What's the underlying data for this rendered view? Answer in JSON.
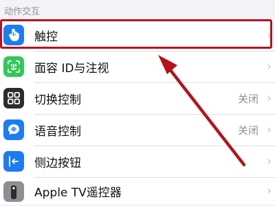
{
  "section": {
    "title": "动作交互"
  },
  "rows": [
    {
      "label": "触控",
      "value": "",
      "icon": "hand-pointer-icon",
      "icon_bg": "#1c7cf2"
    },
    {
      "label": "面容 ID与注视",
      "value": "",
      "icon": "face-id-icon",
      "icon_bg": "#34c759"
    },
    {
      "label": "切换控制",
      "value": "关闭",
      "icon": "switch-control-icon",
      "icon_bg": "#2c2c2e"
    },
    {
      "label": "语音控制",
      "value": "关闭",
      "icon": "voice-control-icon",
      "icon_bg": "#1c7cf2"
    },
    {
      "label": "侧边按钮",
      "value": "",
      "icon": "side-button-icon",
      "icon_bg": "#1c7cf2"
    },
    {
      "label": "Apple TV遥控器",
      "value": "",
      "icon": "remote-icon",
      "icon_bg": "#8e8e93"
    }
  ],
  "annotation": {
    "highlight_color": "#b5121b"
  }
}
